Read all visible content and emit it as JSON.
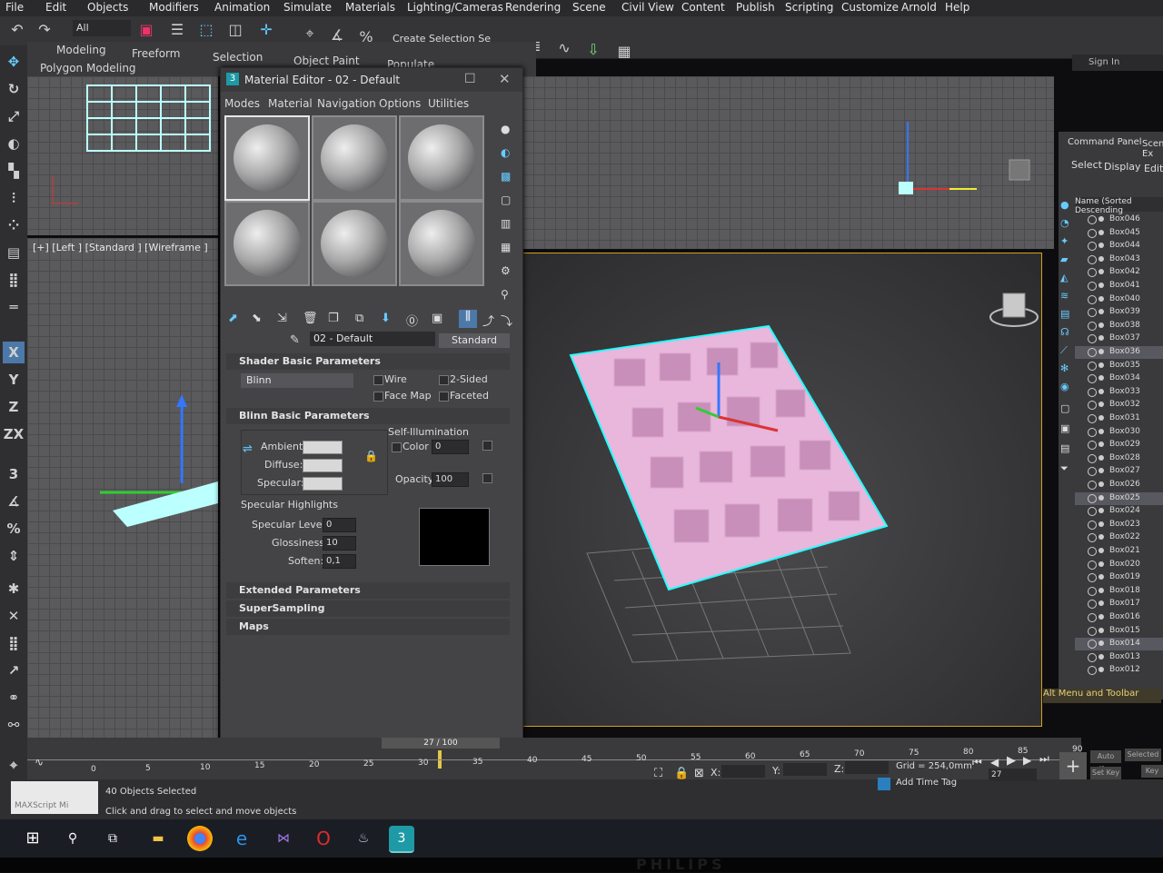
{
  "menu": [
    "File",
    "Edit",
    "Objects",
    "Modifiers",
    "Animation",
    "Simulate",
    "Materials",
    "Lighting/Cameras",
    "Rendering",
    "Scene",
    "Civil View",
    "Content",
    "Publish",
    "Scripting",
    "Customize",
    "Arnold",
    "Help"
  ],
  "toolbar": {
    "filter_value": "All",
    "selection_set": "Create Selection Se",
    "sign_in": "Sign In"
  },
  "ribbon": {
    "tabs": [
      "Modeling",
      "Freeform",
      "Selection",
      "Object Paint",
      "Populate"
    ],
    "subtitle": "Polygon Modeling"
  },
  "left_tools": [
    "X",
    "Y",
    "Z",
    "ZX"
  ],
  "viewports": {
    "left_label": "[+] [Left ] [Standard ] [Wireframe ]"
  },
  "material_editor": {
    "title": "Material Editor - 02 - Default",
    "menu": [
      "Modes",
      "Material",
      "Navigation",
      "Options",
      "Utilities"
    ],
    "material_name": "02 - Default",
    "material_type": "Standard",
    "rollouts": {
      "shader_basic": "Shader Basic Parameters",
      "blinn_basic": "Blinn Basic Parameters",
      "extended": "Extended Parameters",
      "supersampling": "SuperSampling",
      "maps": "Maps"
    },
    "shader": {
      "value": "Blinn",
      "wire": "Wire",
      "two_sided": "2-Sided",
      "face_map": "Face Map",
      "faceted": "Faceted"
    },
    "blinn": {
      "ambient": "Ambient:",
      "diffuse": "Diffuse:",
      "specular": "Specular:",
      "self_illumination": "Self-Illumination",
      "color_label": "Color",
      "color_value": "0",
      "opacity_label": "Opacity:",
      "opacity_value": "100",
      "specular_highlights": "Specular Highlights",
      "specular_level_label": "Specular Level:",
      "specular_level_value": "0",
      "glossiness_label": "Glossiness:",
      "glossiness_value": "10",
      "soften_label": "Soften:",
      "soften_value": "0,1"
    }
  },
  "command_panel": {
    "title": "Command Panel",
    "scene_tab": "Scene Ex",
    "tabs": [
      "Select",
      "Display",
      "Edit"
    ],
    "column_header": "Name (Sorted Descending",
    "objects": [
      "Box046",
      "Box045",
      "Box044",
      "Box043",
      "Box042",
      "Box041",
      "Box040",
      "Box039",
      "Box038",
      "Box037",
      "Box036",
      "Box035",
      "Box034",
      "Box033",
      "Box032",
      "Box031",
      "Box030",
      "Box029",
      "Box028",
      "Box027",
      "Box026",
      "Box025",
      "Box024",
      "Box023",
      "Box022",
      "Box021",
      "Box020",
      "Box019",
      "Box018",
      "Box017",
      "Box016",
      "Box015",
      "Box014",
      "Box013",
      "Box012"
    ],
    "footer": "Alt Menu and Toolbar"
  },
  "timeline": {
    "frame_display": "27 / 100",
    "ticks": [
      "0",
      "5",
      "10",
      "15",
      "20",
      "25",
      "30",
      "35",
      "40",
      "45",
      "50",
      "55",
      "60",
      "65",
      "70",
      "75",
      "80",
      "85",
      "90"
    ]
  },
  "status": {
    "selected": "40 Objects Selected",
    "hint": "Click and drag to select and move objects",
    "maxscript": "MAXScript Mi",
    "x_label": "X:",
    "y_label": "Y:",
    "z_label": "Z:",
    "grid": "Grid = 254,0mm",
    "add_time_tag": "Add Time Tag",
    "current_frame": "27",
    "auto_key": "Auto Key",
    "selected_btn": "Selected",
    "set_key": "Set Key",
    "key": "Key"
  },
  "taskbar": {
    "icons": [
      "windows-icon",
      "search-icon",
      "task-view-icon",
      "chrome-icon",
      "edge-icon",
      "visual-studio-icon",
      "opera-icon",
      "steam-icon",
      "3dsmax-icon"
    ]
  },
  "monitor_brand": "PHILIPS"
}
